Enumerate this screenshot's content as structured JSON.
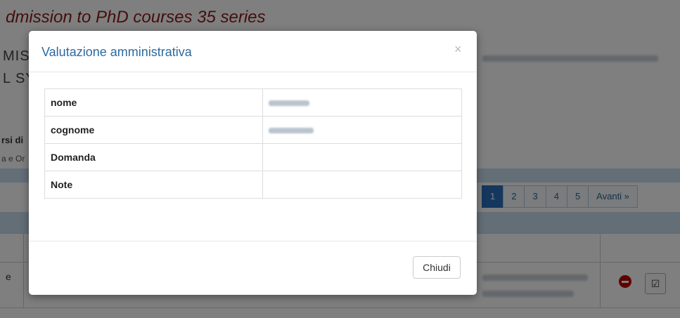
{
  "background": {
    "page_title": "dmission to PhD courses 35 series",
    "heading_line1": "MISS",
    "heading_line2": "L SY",
    "sub_heading": "rsi di",
    "sub_text": "a e Or",
    "pagination": [
      "1",
      "2",
      "3",
      "4",
      "5",
      "Avanti »"
    ],
    "pagination_active": "1",
    "row_cell_text": "e"
  },
  "modal": {
    "title": "Valutazione amministrativa",
    "close_label": "×",
    "rows": [
      {
        "key": "nome"
      },
      {
        "key": "cognome"
      },
      {
        "key": "Domanda"
      },
      {
        "key": "Note"
      }
    ],
    "close_button_label": "Chiudi"
  },
  "colors": {
    "title_red": "#8b1a1a",
    "modal_title_blue": "#2b6a9f",
    "pagination_active": "#2a6ebb",
    "band_blue": "#c9dcef"
  }
}
